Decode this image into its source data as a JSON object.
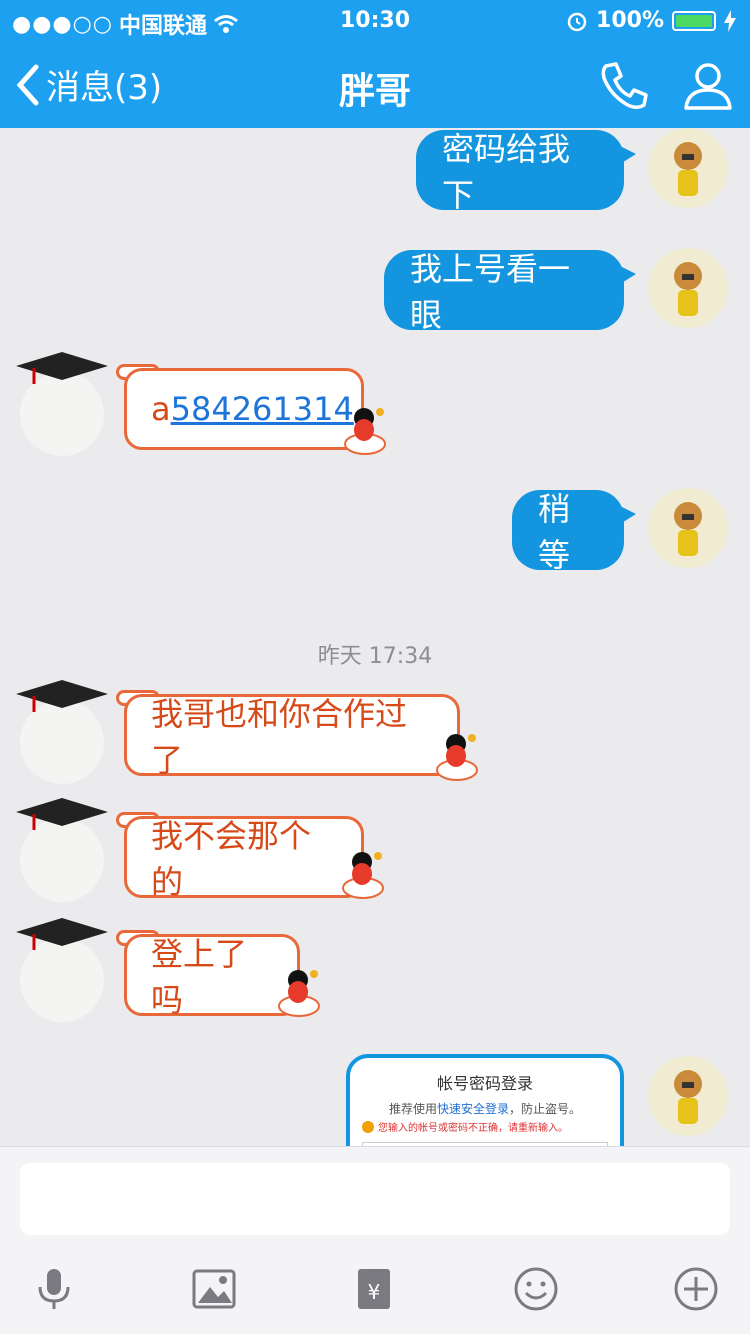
{
  "status_bar": {
    "signal_dots": "●●●○○",
    "carrier": "中国联通",
    "time": "10:30",
    "battery_percent": "100%"
  },
  "nav": {
    "back_label": "消息(3)",
    "title": "胖哥"
  },
  "timestamp": "昨天 17:34",
  "messages": [
    {
      "from": "me",
      "text": "密码给我下"
    },
    {
      "from": "me",
      "text": "我上号看一眼"
    },
    {
      "from": "other",
      "prefix": "a",
      "link": "584261314"
    },
    {
      "from": "me",
      "text": "稍等"
    },
    {
      "from": "other",
      "text": "我哥也和你合作过了"
    },
    {
      "from": "other",
      "text": "我不会那个的"
    },
    {
      "from": "other",
      "text": "登上了吗"
    }
  ],
  "login_card": {
    "title": "帐号密码登录",
    "line_prefix": "推荐使用",
    "line_link": "快速安全登录",
    "line_suffix": "，防止盗号。",
    "warning": "您输入的帐号或密码不正确，请重新输入。"
  },
  "icons": {
    "back": "chevron-left-icon",
    "call": "phone-icon",
    "profile": "person-icon",
    "voice": "microphone-icon",
    "photo": "image-icon",
    "red_packet": "red-packet-icon",
    "emoji": "smiley-icon",
    "more": "plus-circle-icon"
  },
  "colors": {
    "header": "#1ea0f0",
    "bubble_me": "#1396df",
    "bubble_other_border": "#e8683a",
    "bubble_other_text": "#d64a1a",
    "background": "#ebebee"
  }
}
